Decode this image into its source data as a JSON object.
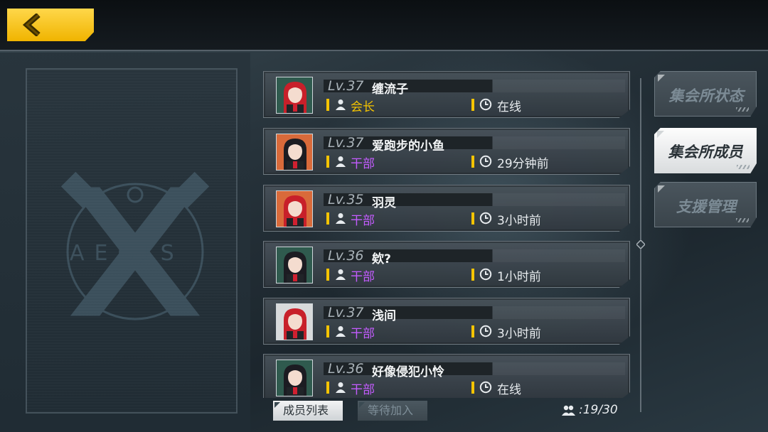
{
  "colors": {
    "accent": "#f5c400",
    "leader_role": "#f5c400",
    "officer_role": "#c45cff",
    "active_tab_bg": "#f2f3f4"
  },
  "header": {
    "back_icon": "chevron-left-icon"
  },
  "side_panel": {
    "emblem_letters": "AEGIS"
  },
  "members": [
    {
      "level": "Lv.37",
      "name": "缠流子",
      "role": "会长",
      "role_type": "leader",
      "status": "在线",
      "avatar": "red-hair-girl-icon",
      "avatar_bg": "#2f5a4e"
    },
    {
      "level": "Lv.37",
      "name": "爱跑步的小鱼",
      "role": "干部",
      "role_type": "officer",
      "status": "29分钟前",
      "avatar": "dark-hair-girl-icon",
      "avatar_bg": "#d96a3a"
    },
    {
      "level": "Lv.35",
      "name": "羽灵",
      "role": "干部",
      "role_type": "officer",
      "status": "3小时前",
      "avatar": "red-hair-girl-icon",
      "avatar_bg": "#d96a3a"
    },
    {
      "level": "Lv.36",
      "name": "欸?",
      "role": "干部",
      "role_type": "officer",
      "status": "1小时前",
      "avatar": "dark-hair-girl-icon",
      "avatar_bg": "#2f5a4e"
    },
    {
      "level": "Lv.37",
      "name": "浅间",
      "role": "干部",
      "role_type": "officer",
      "status": "3小时前",
      "avatar": "red-hair-girl-icon",
      "avatar_bg": "#d8dadb"
    },
    {
      "level": "Lv.36",
      "name": "好像侵犯小怜",
      "role": "干部",
      "role_type": "officer",
      "status": "在线",
      "avatar": "dark-hair-girl-icon",
      "avatar_bg": "#2f5a4e"
    }
  ],
  "tabs": [
    {
      "label": "集会所状态",
      "active": false
    },
    {
      "label": "集会所成员",
      "active": true
    },
    {
      "label": "支援管理",
      "active": false
    }
  ],
  "bottom_tabs": [
    {
      "label": "成员列表",
      "active": true
    },
    {
      "label": "等待加入",
      "active": false
    }
  ],
  "member_count": ":19/30"
}
